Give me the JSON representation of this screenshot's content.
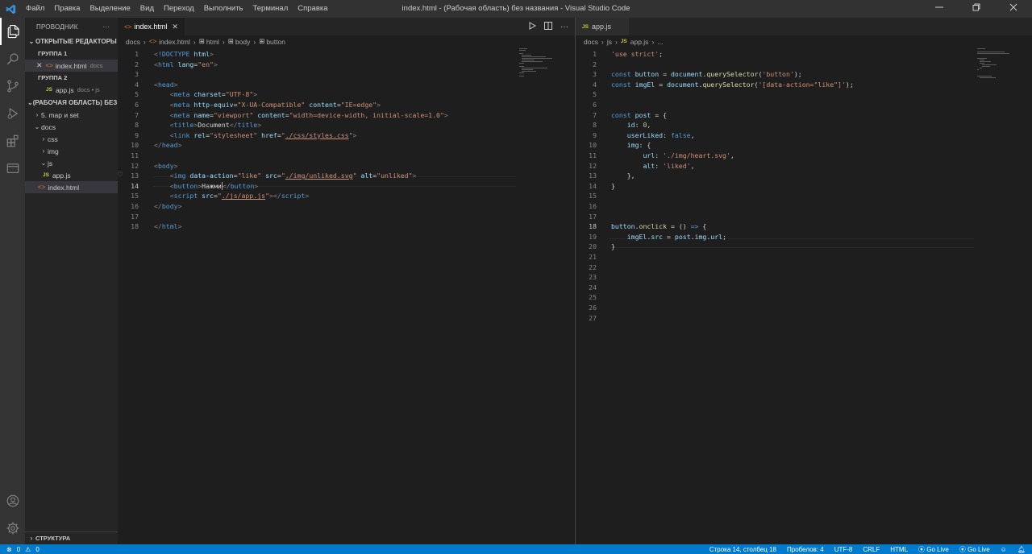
{
  "titlebar": {
    "menu": [
      "Файл",
      "Правка",
      "Выделение",
      "Вид",
      "Переход",
      "Выполнить",
      "Терминал",
      "Справка"
    ],
    "title": "index.html - (Рабочая область) без названия - Visual Studio Code",
    "accent": "#3c8cd8"
  },
  "sidebar": {
    "header": "ПРОВОДНИК",
    "more": "···",
    "open_editors": "ОТКРЫТЫЕ РЕДАКТОРЫ",
    "group1": "ГРУППА 1",
    "group1_file": "index.html",
    "group1_file_desc": "docs",
    "group2": "ГРУППА 2",
    "group2_file": "app.js",
    "group2_file_desc": "docs • js",
    "workspace": "(РАБОЧАЯ ОБЛАСТЬ) БЕЗ ...",
    "tree": [
      "5. map и set",
      "docs",
      "css",
      "img",
      "js",
      "app.js",
      "index.html"
    ],
    "outline": "СТРУКТУРА"
  },
  "editor1": {
    "tab": "index.html",
    "breadcrumb": [
      "docs",
      "index.html",
      "html",
      "body",
      "button"
    ]
  },
  "editor2": {
    "tab": "app.js",
    "breadcrumb": [
      "docs",
      "js",
      "app.js",
      "..."
    ]
  },
  "statusbar": {
    "errors": "0",
    "warnings": "0",
    "position": "Строка 14, столбец 18",
    "spaces": "Пробелов: 4",
    "encoding": "UTF-8",
    "eol": "CRLF",
    "language": "HTML",
    "golive1": "Go Live",
    "golive2": "Go Live",
    "background": "#007acc"
  },
  "icons": {
    "explorer": "files-icon",
    "search": "search-icon",
    "scm": "source-control-icon",
    "run": "run-debug-icon",
    "extensions": "extensions-icon",
    "remote": "remote-explorer-icon",
    "account": "account-icon",
    "settings": "gear-icon"
  }
}
